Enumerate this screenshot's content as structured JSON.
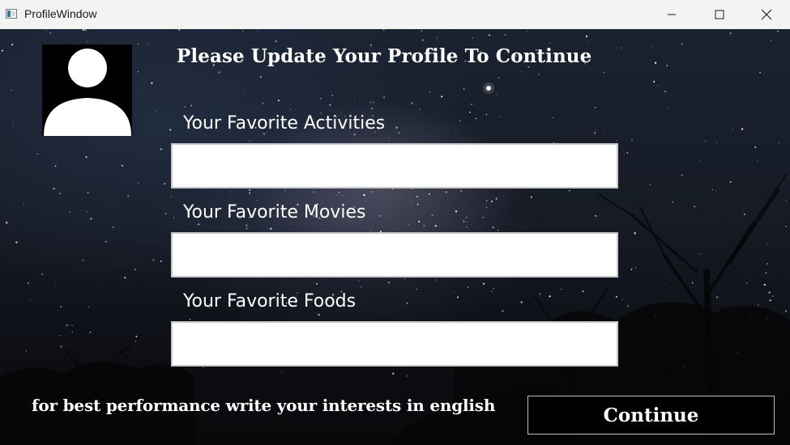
{
  "window": {
    "title": "ProfileWindow",
    "app_icon": "app-window-icon",
    "controls": {
      "minimize_icon": "minimize-icon",
      "maximize_icon": "maximize-icon",
      "close_icon": "close-icon"
    }
  },
  "profile": {
    "avatar_icon": "user-silhouette-icon",
    "heading": "Please Update Your Profile To Continue"
  },
  "form": {
    "fields": [
      {
        "label": "Your Favorite Activities",
        "value": "",
        "placeholder": ""
      },
      {
        "label": "Your Favorite Movies",
        "value": "",
        "placeholder": ""
      },
      {
        "label": "Your Favorite Foods",
        "value": "",
        "placeholder": ""
      }
    ],
    "hint": "for best performance write your interests in english",
    "continue_label": "Continue"
  },
  "colors": {
    "text": "#ffffff",
    "titlebar": "#f3f3f3",
    "button_bg": "#000000",
    "input_bg": "#ffffff"
  }
}
